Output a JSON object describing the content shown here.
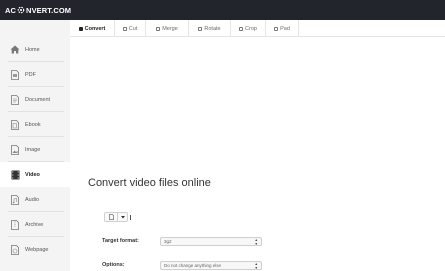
{
  "header": {
    "logo_left": "AC",
    "logo_right": "NVERT.COM",
    "logo_icon": "gear-icon"
  },
  "tabs": [
    {
      "label": "Convert",
      "active": true
    },
    {
      "label": "Cut",
      "active": false
    },
    {
      "label": "Merge",
      "active": false
    },
    {
      "label": "Rotate",
      "active": false
    },
    {
      "label": "Crop",
      "active": false
    },
    {
      "label": "Pad",
      "active": false
    }
  ],
  "sidebar": {
    "items": [
      {
        "label": "Home",
        "icon": "home-icon",
        "active": false
      },
      {
        "label": "PDF",
        "icon": "pdf-file-icon",
        "active": false
      },
      {
        "label": "Document",
        "icon": "document-icon",
        "active": false
      },
      {
        "label": "Ebook",
        "icon": "ebook-icon",
        "active": false
      },
      {
        "label": "Image",
        "icon": "image-file-icon",
        "active": false
      },
      {
        "label": "Video",
        "icon": "video-icon",
        "active": true
      },
      {
        "label": "Audio",
        "icon": "audio-file-icon",
        "active": false
      },
      {
        "label": "Archive",
        "icon": "archive-icon",
        "active": false
      },
      {
        "label": "Webpage",
        "icon": "webpage-icon",
        "active": false
      }
    ]
  },
  "main": {
    "title": "Convert video files online",
    "upload": {
      "file_icon": "file-icon",
      "dropdown_icon": "caret-down-icon"
    },
    "target_format": {
      "label": "Target format:",
      "value": "3g2"
    },
    "options": {
      "label": "Options:",
      "value": "Do not change anything else"
    }
  },
  "colors": {
    "topbar": "#22262c",
    "sidebar": "#f4f4f4",
    "active_tab_marker": "#222222"
  }
}
